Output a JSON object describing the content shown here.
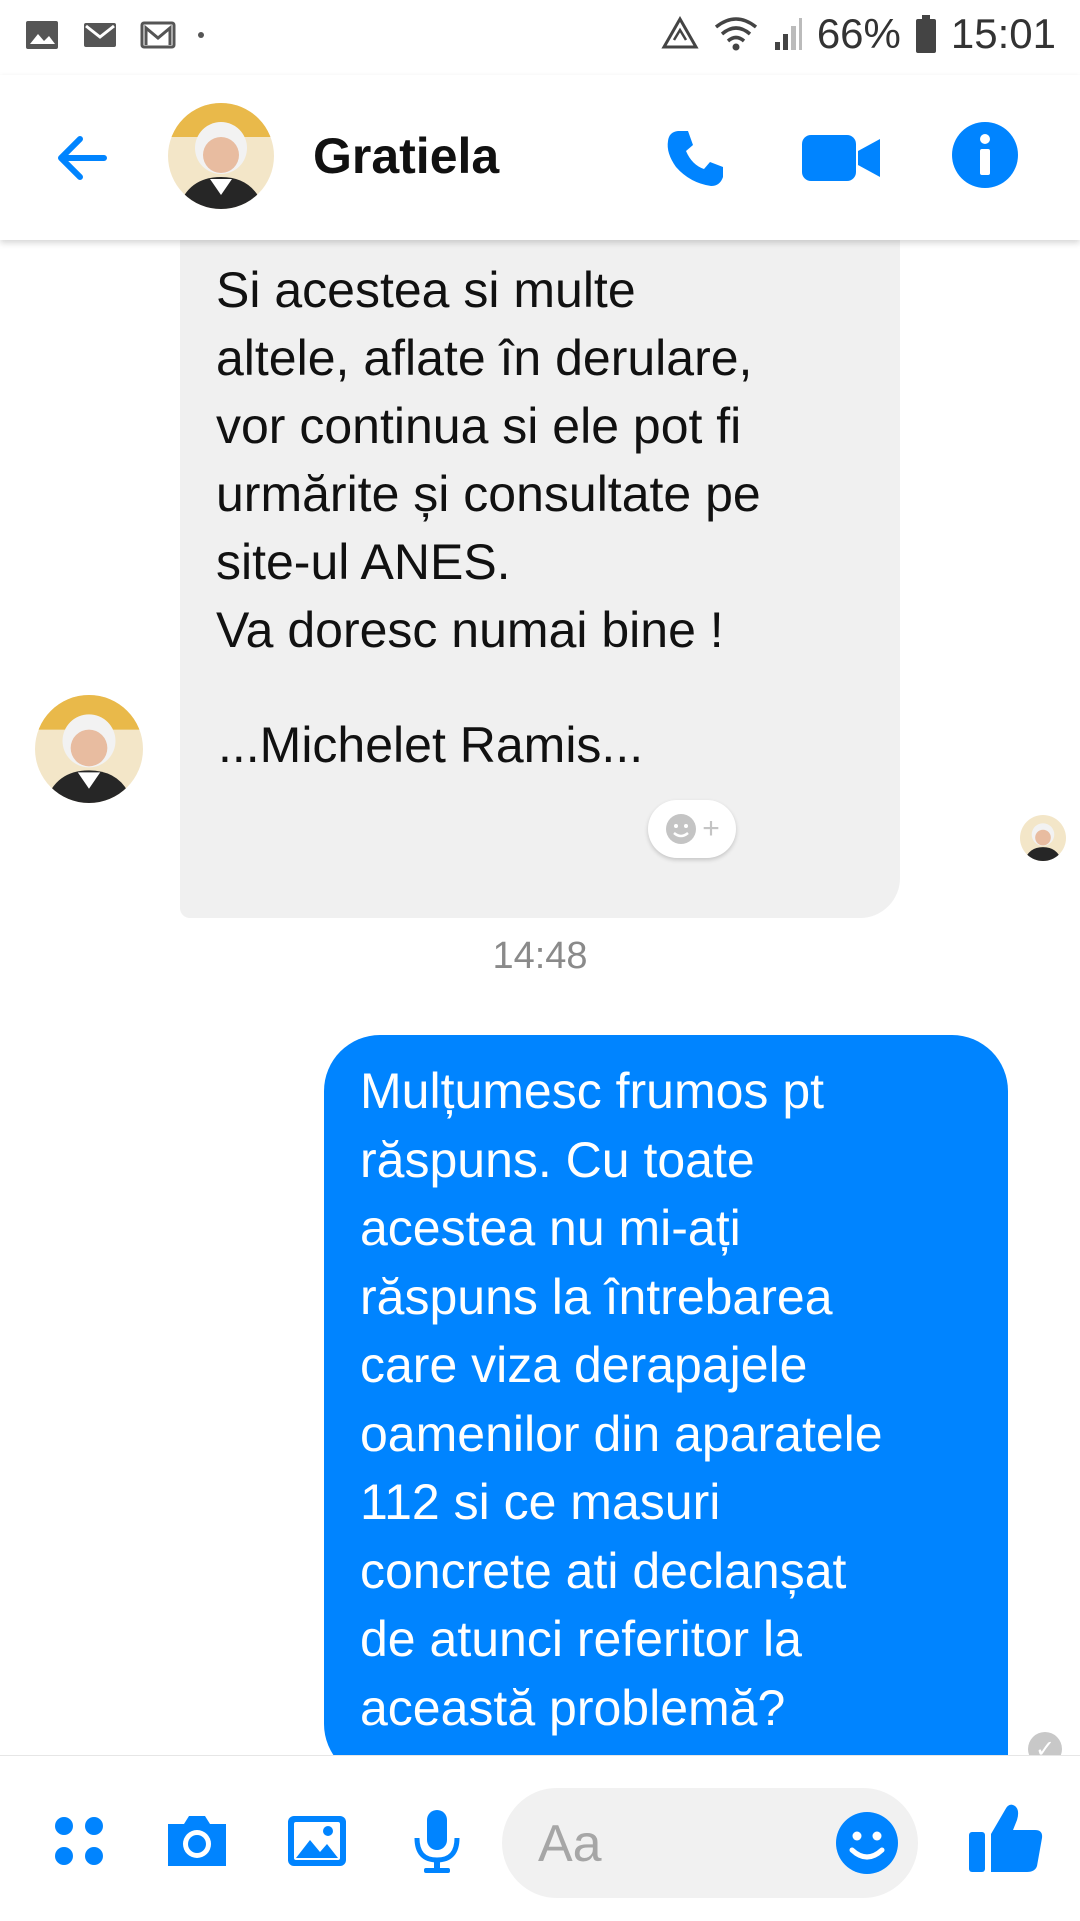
{
  "status_bar": {
    "battery": "66%",
    "time": "15:01",
    "left_icons": [
      "image-notification-icon",
      "email-notification-icon",
      "gmail-notification-icon"
    ],
    "right_icons": [
      "data-saver-icon",
      "wifi-icon",
      "signal-icon",
      "battery-icon"
    ]
  },
  "header": {
    "contact_name": "Gratiela",
    "accent_color": "#0084ff"
  },
  "messages": {
    "incoming_1_lines": [
      "Si acestea si multe",
      "altele, aflate în derulare,",
      "vor continua si ele pot fi",
      "urmărite și consultate pe",
      "site-ul ANES.",
      "Va doresc numai bine !"
    ],
    "incoming_2": "...Michelet Ramis...",
    "timestamp": "14:48",
    "outgoing_lines": [
      "Mulțumesc frumos pt",
      "răspuns. Cu toate",
      "acestea nu mi-ați",
      "răspuns la întrebarea",
      "care viza derapajele",
      "oamenilor din aparatele",
      "112 si ce masuri",
      "concrete ati declanșat",
      "de atunci referitor la",
      "această problemă?"
    ]
  },
  "composer": {
    "placeholder": "Aa"
  }
}
